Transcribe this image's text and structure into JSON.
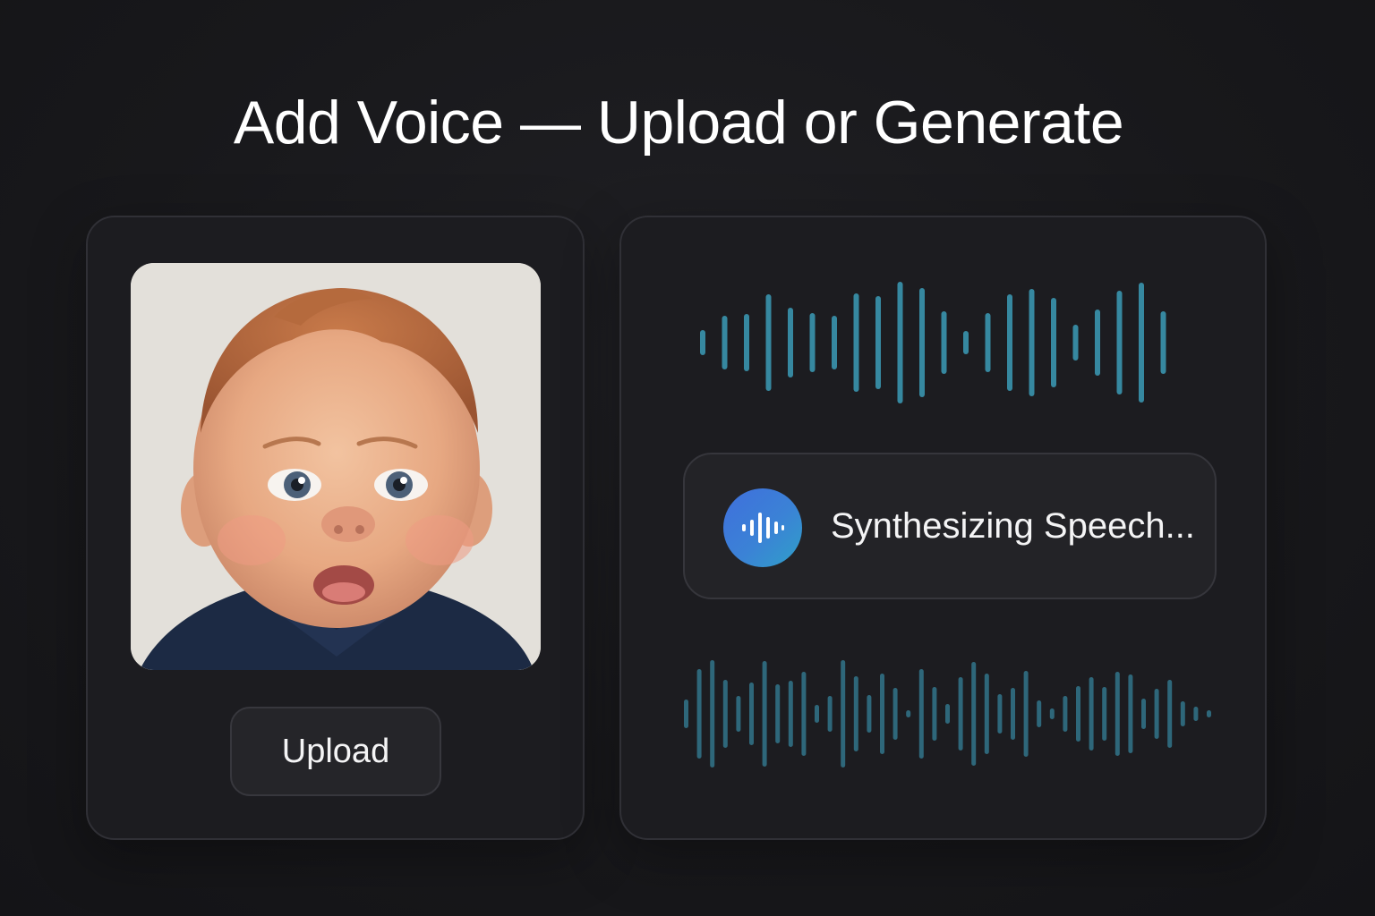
{
  "header": {
    "title": "Add Voice — Upload or Generate"
  },
  "upload_panel": {
    "photo_subject": "baby-portrait",
    "upload_label": "Upload"
  },
  "generate_panel": {
    "status_label": "Synthesizing Speech...",
    "status_icon": "waveform-icon"
  },
  "colors": {
    "background": "#18181b",
    "card": "#1c1c20",
    "wave_accent": "#3ea6c4",
    "icon_gradient_start": "#3f6fdc",
    "icon_gradient_end": "#2fa0c8"
  }
}
